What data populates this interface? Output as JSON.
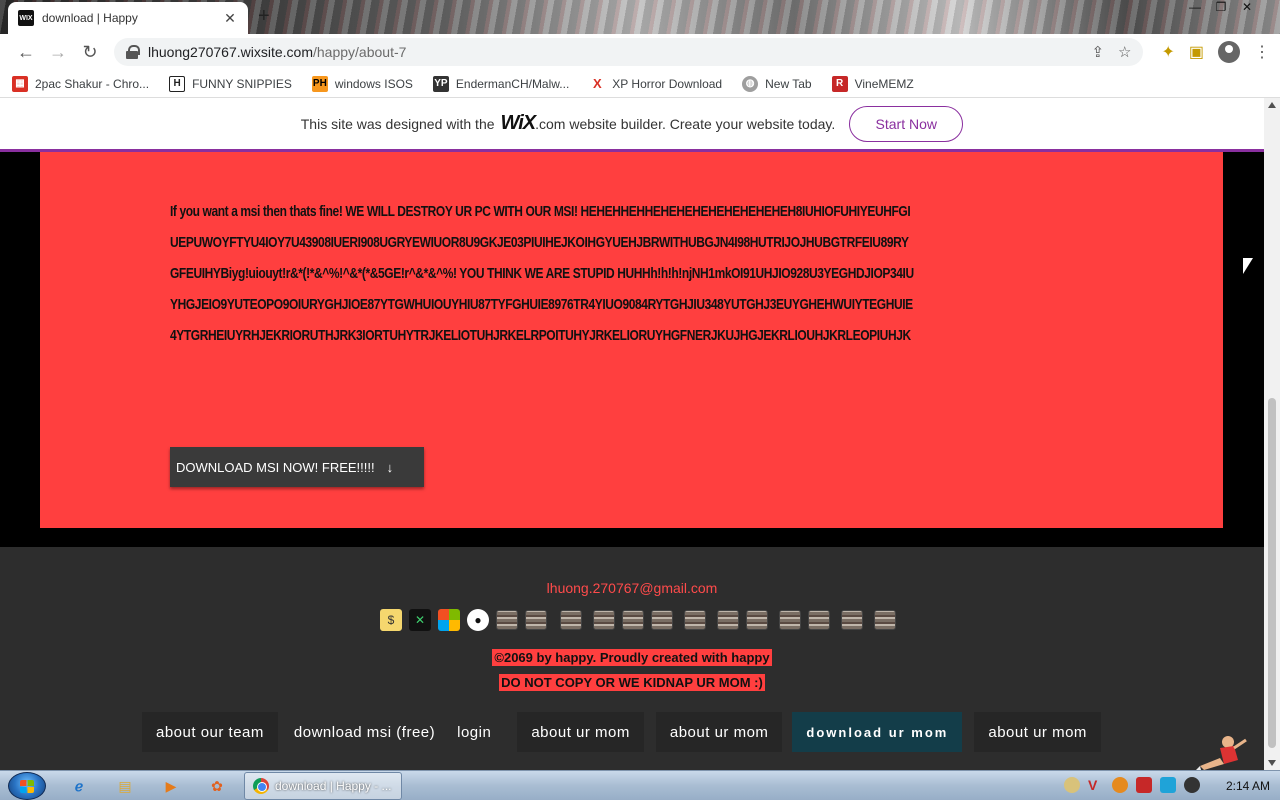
{
  "browser": {
    "tab_title": "download | Happy",
    "favicon_text": "WIX",
    "url_host": "lhuong270767.wixsite.com",
    "url_path": "/happy/about-7"
  },
  "bookmarks": [
    {
      "label": "2pac Shakur - Chro...",
      "icon": "calendar-icon",
      "color": "#d93025"
    },
    {
      "label": "FUNNY SNIPPIES",
      "icon": "H",
      "color": "#222222"
    },
    {
      "label": "windows ISOS",
      "icon": "PH",
      "color": "#f7971d"
    },
    {
      "label": "EndermanCH/Malw...",
      "icon": "YP",
      "color": "#333333"
    },
    {
      "label": "XP Horror Download",
      "icon": "X",
      "color": "#d93025"
    },
    {
      "label": "New Tab",
      "icon": "globe-icon",
      "color": "#777777"
    },
    {
      "label": "VineMEMZ",
      "icon": "R",
      "color": "#c62828"
    }
  ],
  "wix_banner": {
    "text_before": "This site was designed with the",
    "logo": "WiX",
    "text_after": ".com website builder. Create your website today.",
    "cta": "Start Now"
  },
  "content": {
    "message": "If you want a msi then thats fine! WE WILL DESTROY UR PC WITH OUR MSI! HEHEHHEHHEHEHEHEHEHEHEHEHEH8IUHIOFUHIYEUHFGIUEPUWOYFTYU4IOY7U43908IUERI908UGRYEWIUOR8U9GKJE03PIUIHEJKOIHGYUEHJBRWITHUBGJN4I98HUTRIJOJHUBGTRFEIU89RYGFEUIHYBiyg!uiouyt!r&*(!*&^%!^&*(*&5GE!r^&*&^%! YOU THINK WE ARE STUPID HUHHh!h!h!njNH1mkOI91UHJIO928U3YEGHDJIOP34IUYHGJEIO9YUTEOPO9OIURYGHJIOE87YTGWHUIOUYHIU87TYFGHUIE8976TR4YIUO9084RYTGHJIU348YUTGHJ3EUYGHEHWUIYTEGHUIE4YTGRHEIUYRHJEKRIORUTHJRK3IORTUHYTRJKELIOTUHJRKELRPOITUHYJRKELIORUYHGFNERJKUJHGJEKRLIOUHJKRLEOPIUHJK",
    "download_button": "DOWNLOAD MSI NOW! FREE!!!!!",
    "download_icon": "↓"
  },
  "footer": {
    "email": "lhuong.270767@gmail.com",
    "copyright": "©2069 by happy. Proudly created with happy",
    "warning": "DO NOT COPY OR WE KIDNAP UR MOM :)",
    "nav": [
      {
        "label": "about our team",
        "style": "box"
      },
      {
        "label": "download msi (free)",
        "style": "plain"
      },
      {
        "label": "login",
        "style": "plain"
      },
      {
        "label": "about ur mom",
        "style": "box"
      },
      {
        "label": "about ur mom",
        "style": "box"
      },
      {
        "label": "download ur mom",
        "style": "active"
      },
      {
        "label": "about ur mom",
        "style": "box"
      }
    ]
  },
  "taskbar": {
    "active_window": "download | Happy - ...",
    "clock": "2:14 AM"
  },
  "colors": {
    "accent_red": "#ff3f3f",
    "wix_purple": "#8a2f9f",
    "footer_bg": "#2d2d2d",
    "active_nav": "#133d49"
  }
}
